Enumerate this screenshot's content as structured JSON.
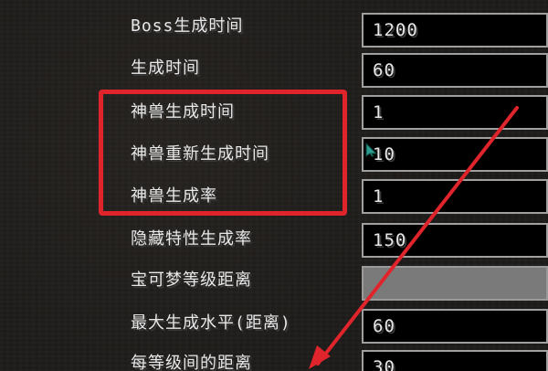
{
  "settings": {
    "rows": [
      {
        "label": "Boss生成时间",
        "value": "1200"
      },
      {
        "label": "生成时间",
        "value": "60"
      },
      {
        "label": "神兽生成时间",
        "value": "1"
      },
      {
        "label": "神兽重新生成时间",
        "value": "10"
      },
      {
        "label": "神兽生成率",
        "value": "1"
      },
      {
        "label": "隐藏特性生成率",
        "value": "150"
      },
      {
        "label": "宝可梦等级距离",
        "value": ""
      },
      {
        "label": "最大生成水平(距离)",
        "value": "60"
      },
      {
        "label": "每等级间的距离",
        "value": "30"
      }
    ]
  },
  "annotation": {
    "highlight_color": "#e0242b",
    "arrow_color": "#e0242b"
  },
  "icons": {
    "cursor": "mouse-cursor-icon",
    "arrow": "annotation-arrow-icon"
  }
}
